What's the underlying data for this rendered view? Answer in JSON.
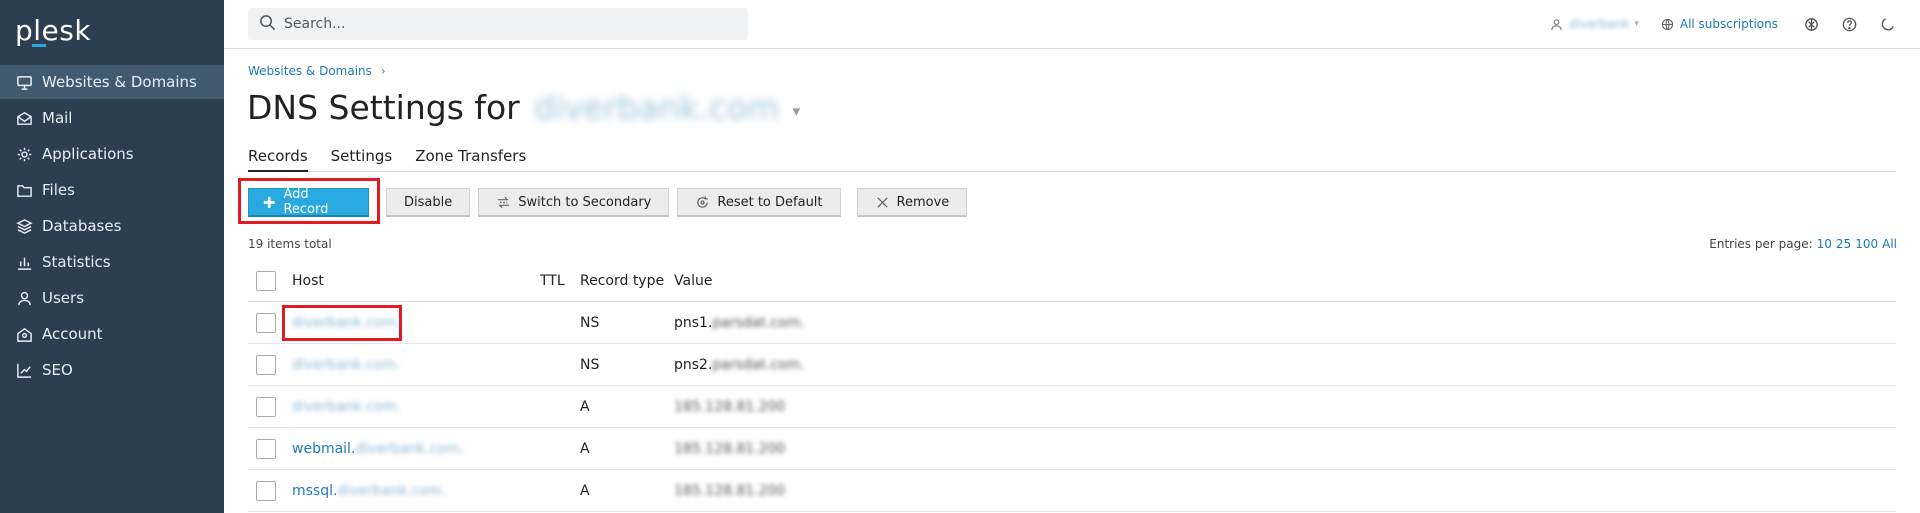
{
  "app": {
    "logo_text": "plesk"
  },
  "sidebar": {
    "items": [
      {
        "label": "Websites & Domains",
        "icon": "monitor-icon",
        "active": true
      },
      {
        "label": "Mail",
        "icon": "mail-icon",
        "active": false
      },
      {
        "label": "Applications",
        "icon": "gear-icon",
        "active": false
      },
      {
        "label": "Files",
        "icon": "folder-icon",
        "active": false
      },
      {
        "label": "Databases",
        "icon": "layers-icon",
        "active": false
      },
      {
        "label": "Statistics",
        "icon": "bar-chart-icon",
        "active": false
      },
      {
        "label": "Users",
        "icon": "user-icon",
        "active": false
      },
      {
        "label": "Account",
        "icon": "account-icon",
        "active": false
      },
      {
        "label": "SEO",
        "icon": "seo-chart-icon",
        "active": false
      }
    ]
  },
  "topbar": {
    "search_placeholder": "Search...",
    "user_name": "diverbank",
    "subscriptions_label": "All subscriptions"
  },
  "breadcrumb": {
    "item": "Websites & Domains"
  },
  "page": {
    "title": "DNS Settings for",
    "domain": "diverbank.com"
  },
  "tabs": [
    {
      "label": "Records",
      "active": true
    },
    {
      "label": "Settings",
      "active": false
    },
    {
      "label": "Zone Transfers",
      "active": false
    }
  ],
  "toolbar": {
    "add_record": "Add Record",
    "disable": "Disable",
    "switch_secondary": "Switch to Secondary",
    "reset_default": "Reset to Default",
    "remove": "Remove"
  },
  "list": {
    "count_text": "19 items total",
    "entries_label": "Entries per page:",
    "page_sizes": [
      "10",
      "25",
      "100",
      "All"
    ]
  },
  "table": {
    "headers": {
      "host": "Host",
      "ttl": "TTL",
      "type": "Record type",
      "value": "Value"
    },
    "rows": [
      {
        "host_prefix": "",
        "host_blur": "diverbank.com.",
        "type": "NS",
        "value_prefix": "pns1.",
        "value_blur": "parsdat.com."
      },
      {
        "host_prefix": "",
        "host_blur": "diverbank.com.",
        "type": "NS",
        "value_prefix": "pns2.",
        "value_blur": "parsdat.com."
      },
      {
        "host_prefix": "",
        "host_blur": "diverbank.com.",
        "type": "A",
        "value_prefix": "",
        "value_blur": "185.128.81.200"
      },
      {
        "host_prefix": "webmail.",
        "host_blur": "diverbank.com.",
        "type": "A",
        "value_prefix": "",
        "value_blur": "185.128.81.200"
      },
      {
        "host_prefix": "mssql.",
        "host_blur": "diverbank.com.",
        "type": "A",
        "value_prefix": "",
        "value_blur": "185.128.81.200"
      }
    ]
  },
  "colors": {
    "sidebar_bg": "#2c3e50",
    "accent": "#28aae1",
    "link": "#1f7ab8",
    "highlight": "#e21b23"
  }
}
